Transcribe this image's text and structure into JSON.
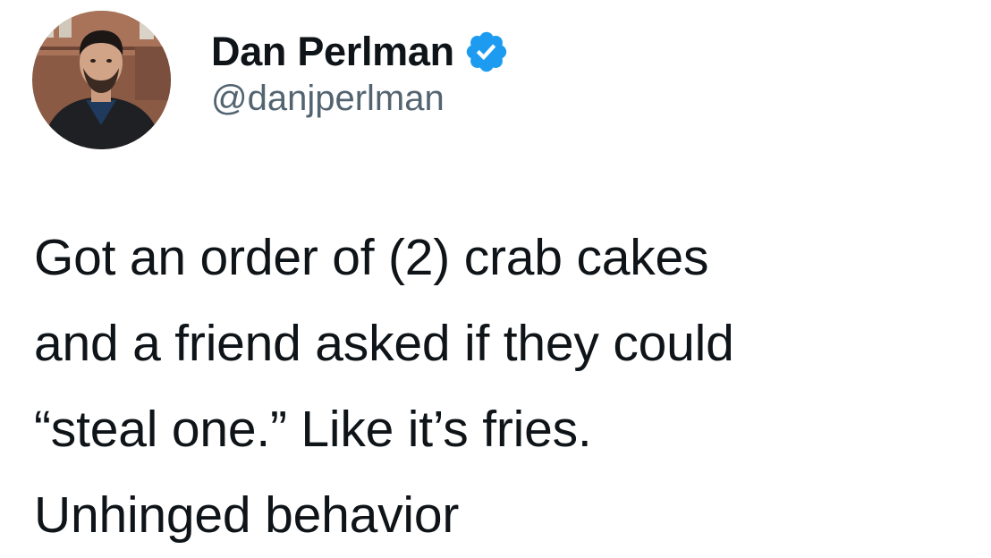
{
  "author": {
    "display_name": "Dan Perlman",
    "handle": "@danjperlman",
    "verified": true,
    "verified_color": "#1d9bf0"
  },
  "tweet": {
    "lines": [
      "Got an order of (2) crab cakes",
      "and a friend asked if they could",
      "“steal one.” Like it’s fries.",
      "Unhinged behavior"
    ]
  },
  "icons": {
    "avatar": "avatar-photo",
    "verified": "verified-badge-icon"
  }
}
